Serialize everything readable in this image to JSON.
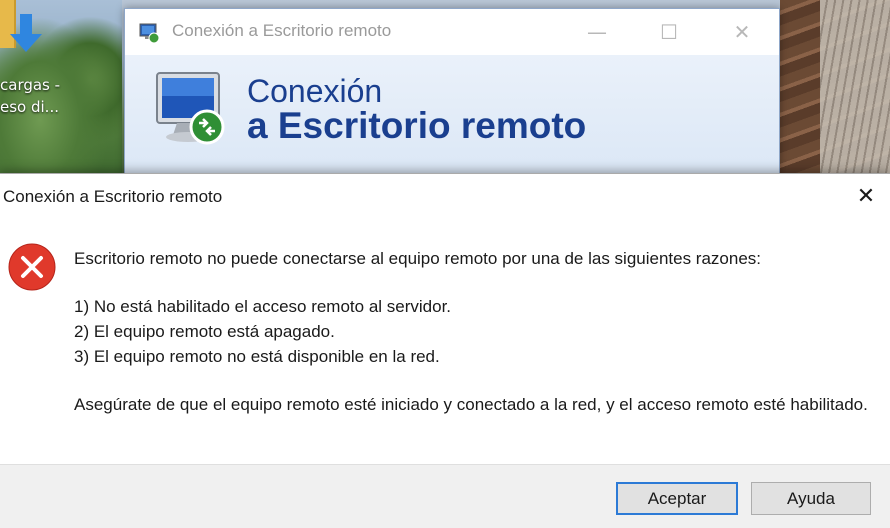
{
  "desktop": {
    "shortcut_label": "cargas -\neso di..."
  },
  "background_window": {
    "title": "Conexión a Escritorio remoto",
    "minimize_glyph": "—",
    "maximize_glyph": "☐",
    "close_glyph": "✕",
    "banner_line1": "Conexión",
    "banner_line2": "a Escritorio remoto"
  },
  "dialog": {
    "title": "Conexión a Escritorio remoto",
    "close_glyph": "✕",
    "icon": "error-icon",
    "message": {
      "intro": "Escritorio remoto no puede conectarse al equipo remoto por una de las siguientes razones:",
      "reasons": [
        "1) No está habilitado el acceso remoto al servidor.",
        "2) El equipo remoto está apagado.",
        "3) El equipo remoto no está disponible en la red."
      ],
      "advice": "Asegúrate de que el equipo remoto esté iniciado y conectado a la red, y el acceso remoto esté habilitado."
    },
    "buttons": {
      "accept": "Aceptar",
      "help": "Ayuda"
    }
  },
  "colors": {
    "accent": "#2c7ad6",
    "banner_text": "#1a3f8f",
    "error": "#e0392b"
  }
}
